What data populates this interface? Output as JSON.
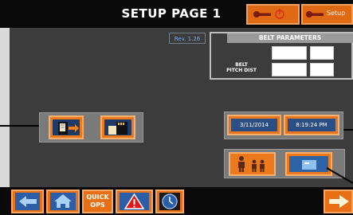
{
  "header": {
    "title": "SETUP PAGE 1",
    "setup_label": "Setup"
  },
  "main": {
    "revision": "Rev. 1.26",
    "belt_parameters": {
      "title": "BELT PARAMETERS",
      "pitch_label_line1": "BELT",
      "pitch_label_line2": "PITCH DIST"
    },
    "date": "3/11/2014",
    "time": "8:19:24 PM"
  },
  "footer": {
    "quick_ops_line1": "QUICK",
    "quick_ops_line2": "OPS"
  },
  "colors": {
    "accent": "#e86f14",
    "panel": "#3c3c3c",
    "tile_inner": "#1e3a66"
  }
}
